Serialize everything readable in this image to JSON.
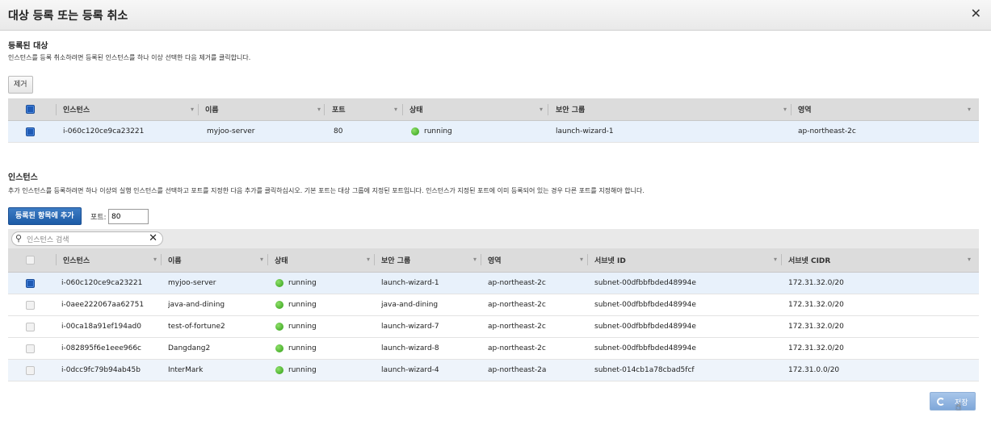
{
  "dialog": {
    "title": "대상 등록 또는 등록 취소",
    "close_icon": "✕"
  },
  "registered": {
    "title": "등록된 대상",
    "desc": "인스턴스를 등록 취소하려면 등록된 인스턴스를 하나 이상 선택한 다음 제거를 클릭합니다.",
    "remove_label": "제거",
    "headers": [
      "인스턴스",
      "이름",
      "포트",
      "상태",
      "보안 그룹",
      "영역"
    ],
    "rows": [
      {
        "instance": "i-060c120ce9ca23221",
        "name": "myjoo-server",
        "port": "80",
        "state": "running",
        "sg": "launch-wizard-1",
        "zone": "ap-northeast-2c"
      }
    ]
  },
  "instances": {
    "title": "인스턴스",
    "desc": "추가 인스턴스를 등록하려면 하나 이상의 실행 인스턴스를 선택하고 포트를 지정한 다음 추가를 클릭하십시오. 기본 포트는 대상 그룹에 지정된 포트입니다. 인스턴스가 지정된 포트에 이미 등록되어 있는 경우 다른 포트를 지정해야 합니다.",
    "add_label": "등록된 항목에 추가",
    "port_label": "포트:",
    "port_value": "80",
    "search_placeholder": "인스턴스 검색",
    "headers": [
      "인스턴스",
      "이름",
      "상태",
      "보안 그룹",
      "영역",
      "서브넷 ID",
      "서브넷 CIDR"
    ],
    "rows": [
      {
        "instance": "i-060c120ce9ca23221",
        "name": "myjoo-server",
        "state": "running",
        "sg": "launch-wizard-1",
        "zone": "ap-northeast-2c",
        "subnet": "subnet-00dfbbfbded48994e",
        "cidr": "172.31.32.0/20",
        "checked": true
      },
      {
        "instance": "i-0aee222067aa62751",
        "name": "java-and-dining",
        "state": "running",
        "sg": "java-and-dining",
        "zone": "ap-northeast-2c",
        "subnet": "subnet-00dfbbfbded48994e",
        "cidr": "172.31.32.0/20",
        "checked": false
      },
      {
        "instance": "i-00ca18a91ef194ad0",
        "name": "test-of-fortune2",
        "state": "running",
        "sg": "launch-wizard-7",
        "zone": "ap-northeast-2c",
        "subnet": "subnet-00dfbbfbded48994e",
        "cidr": "172.31.32.0/20",
        "checked": false
      },
      {
        "instance": "i-082895f6e1eee966c",
        "name": "Dangdang2",
        "state": "running",
        "sg": "launch-wizard-8",
        "zone": "ap-northeast-2c",
        "subnet": "subnet-00dfbbfbded48994e",
        "cidr": "172.31.32.0/20",
        "checked": false
      },
      {
        "instance": "i-0dcc9fc79b94ab45b",
        "name": "InterMark",
        "state": "running",
        "sg": "launch-wizard-4",
        "zone": "ap-northeast-2a",
        "subnet": "subnet-014cb1a78cbad5fcf",
        "cidr": "172.31.0.0/20",
        "checked": false
      }
    ]
  },
  "footer": {
    "save_label": "저장"
  },
  "colors": {
    "accent": "#1c5ba6",
    "running": "#2f9e16",
    "selected_row": "#e8f1fb"
  }
}
